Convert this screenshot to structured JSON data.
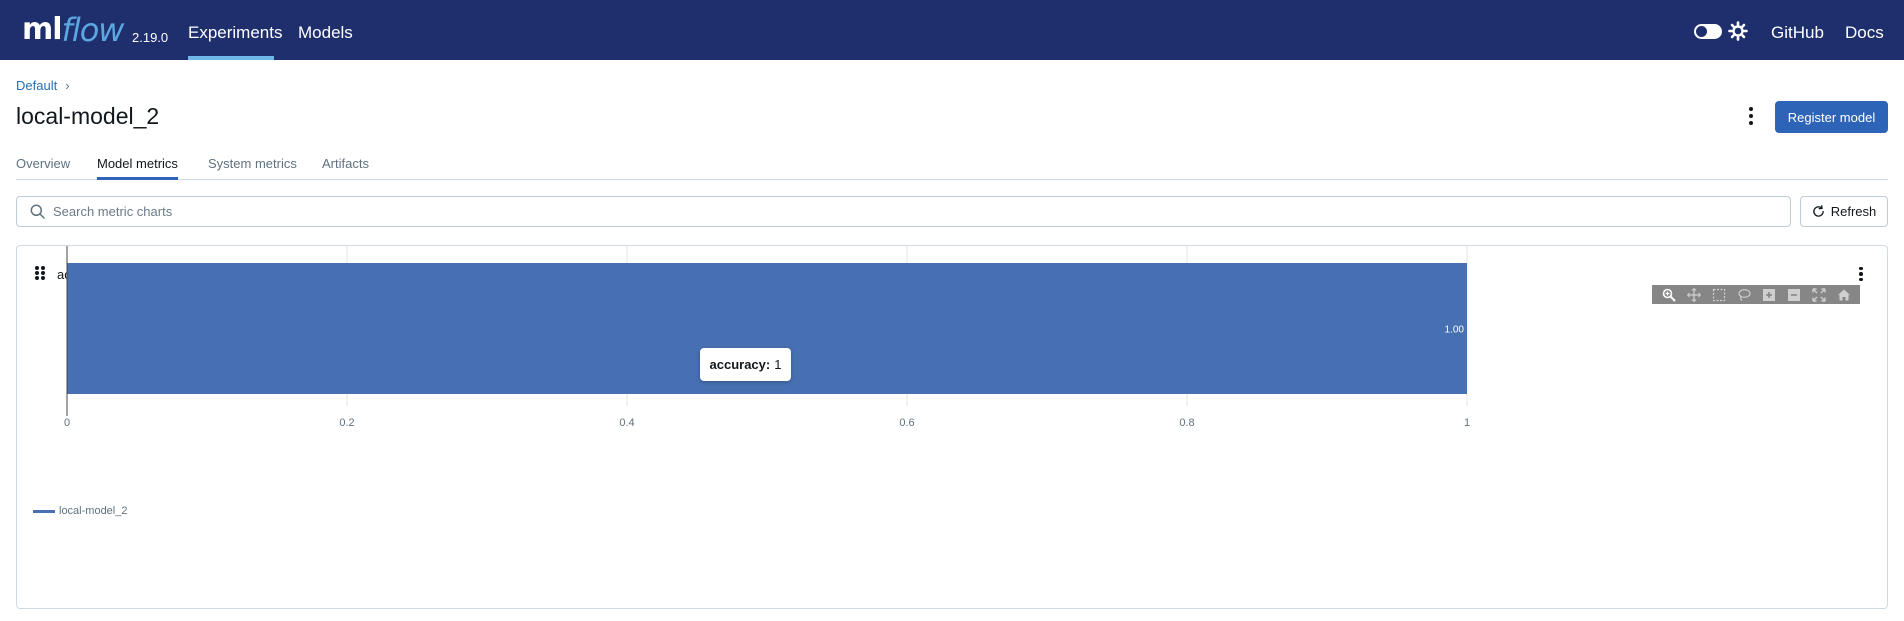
{
  "app": {
    "logo_ml": "ml",
    "logo_flow": "flow",
    "version": "2.19.0",
    "nav": {
      "experiments": "Experiments",
      "models": "Models"
    },
    "right_links": {
      "github": "GitHub",
      "docs": "Docs"
    },
    "theme_toggle": "off"
  },
  "breadcrumb": {
    "items": [
      "Default"
    ]
  },
  "page": {
    "title": "local-model_2",
    "register_label": "Register model"
  },
  "tabs": [
    {
      "label": "Overview",
      "active": false
    },
    {
      "label": "Model metrics",
      "active": true
    },
    {
      "label": "System metrics",
      "active": false
    },
    {
      "label": "Artifacts",
      "active": false
    }
  ],
  "search": {
    "placeholder": "Search metric charts",
    "value": ""
  },
  "refresh_label": "Refresh",
  "card": {
    "title": "accuracy",
    "tooltip": {
      "metric": "accuracy:",
      "value": "1"
    },
    "legend": "local-model_2"
  },
  "modebar_icons": [
    "zoom-icon",
    "pan-icon",
    "box-select-icon",
    "lasso-select-icon",
    "zoom-in-icon",
    "zoom-out-icon",
    "autoscale-icon",
    "reset-axes-icon"
  ],
  "colors": {
    "nav_bg": "#1f2f6e",
    "accent": "#2e64b8",
    "bar": "#4770b3"
  },
  "chart_data": {
    "type": "bar",
    "orientation": "horizontal",
    "categories": [
      "local-model_2"
    ],
    "series": [
      {
        "name": "local-model_2",
        "values": [
          1.0
        ]
      }
    ],
    "data_labels": [
      "1.00"
    ],
    "xlim": [
      0,
      1
    ],
    "x_ticks": [
      "0",
      "0.2",
      "0.4",
      "0.6",
      "0.8",
      "1"
    ],
    "grid": "vertical",
    "legend": "bottom-left"
  }
}
